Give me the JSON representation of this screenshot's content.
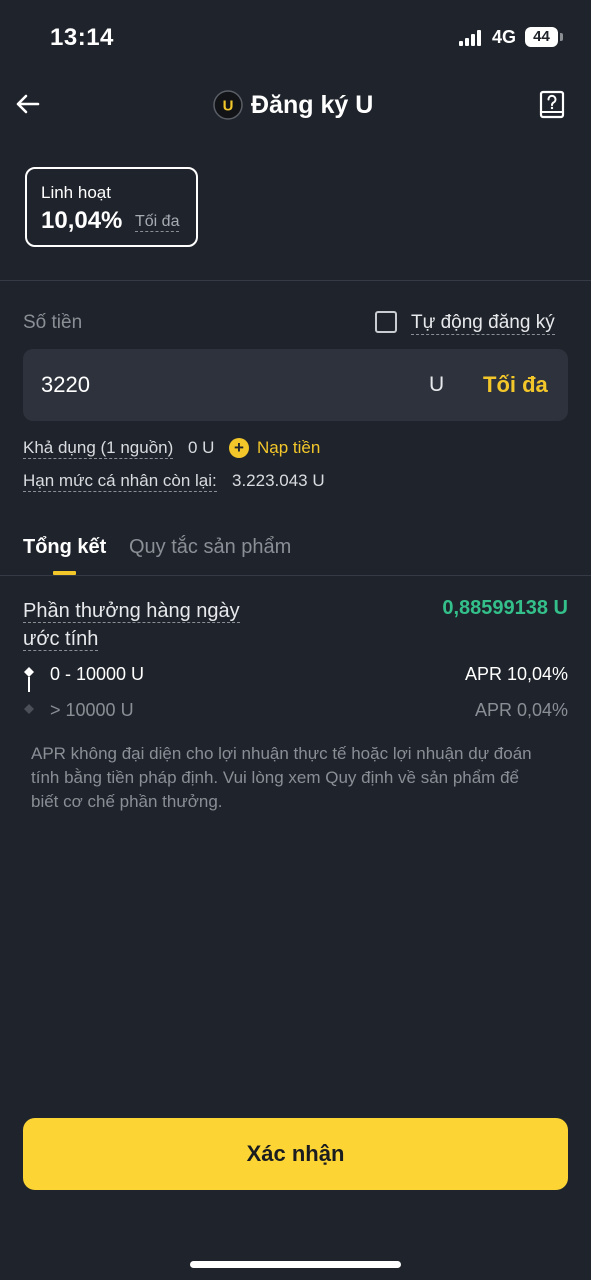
{
  "status_bar": {
    "time": "13:14",
    "network": "4G",
    "battery": "44"
  },
  "header": {
    "title": "Đăng ký U",
    "coin_letter": "U"
  },
  "plan": {
    "name": "Linh hoạt",
    "rate": "10,04%",
    "max_label": "Tối đa"
  },
  "amount": {
    "label": "Số tiền",
    "auto_subscribe_label": "Tự động đăng ký",
    "value": "3220",
    "unit": "U",
    "max_label": "Tối đa"
  },
  "available": {
    "label": "Khả dụng (1 nguồn)",
    "value": "0 U",
    "deposit_label": "Nạp tiền"
  },
  "limit": {
    "label": "Hạn mức cá nhân còn lại:",
    "value": "3.223.043 U"
  },
  "tabs": [
    {
      "label": "Tổng kết",
      "active": true
    },
    {
      "label": "Quy tắc sản phẩm",
      "active": false
    }
  ],
  "rewards": {
    "label_line1": "Phần thưởng hàng ngày",
    "label_line2": "ước tính",
    "value": "0,88599138 U",
    "tiers": [
      {
        "range": "0 - 10000 U",
        "apr": "APR 10,04%"
      },
      {
        "range": "> 10000 U",
        "apr": "APR 0,04%"
      }
    ]
  },
  "disclaimer": "APR không đại diện cho lợi nhuận thực tế hoặc lợi nhuận dự đoán tính bằng tiền pháp định. Vui lòng xem Quy định về sản phẩm để biết cơ chế phần thưởng.",
  "confirm_label": "Xác nhận",
  "colors": {
    "accent": "#fcd535",
    "positive": "#33c08a",
    "background": "#1f232b",
    "input_bg": "#2d323c"
  }
}
